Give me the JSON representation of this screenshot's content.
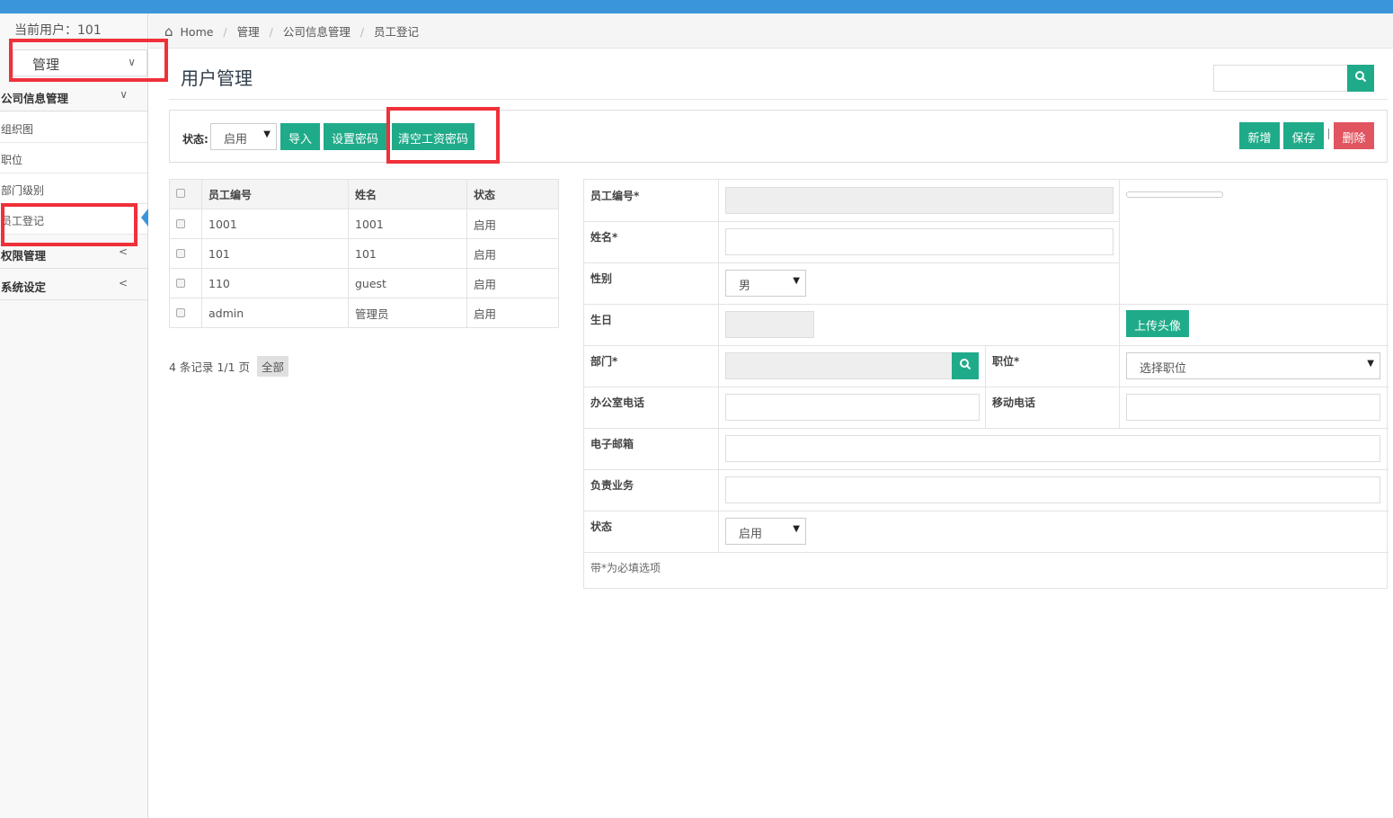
{
  "sidebar": {
    "current_user_label": "当前用户：101",
    "module": "管理",
    "groups": [
      {
        "label": "公司信息管理",
        "items": [
          "组织图",
          "职位",
          "部门级别",
          "员工登记"
        ]
      },
      {
        "label": "权限管理"
      },
      {
        "label": "系统设定"
      }
    ]
  },
  "breadcrumb": [
    "Home",
    "管理",
    "公司信息管理",
    "员工登记"
  ],
  "page_title": "用户管理",
  "toolbar": {
    "status_label": "状态:",
    "status_value": "启用",
    "import": "导入",
    "set_password": "设置密码",
    "clear_salary_password": "清空工资密码",
    "add": "新增",
    "save": "保存",
    "delete": "删除"
  },
  "table": {
    "headers": [
      "员工编号",
      "姓名",
      "状态"
    ],
    "rows": [
      [
        "1001",
        "1001",
        "启用"
      ],
      [
        "101",
        "101",
        "启用"
      ],
      [
        "110",
        "guest",
        "启用"
      ],
      [
        "admin",
        "管理员",
        "启用"
      ]
    ]
  },
  "pager": {
    "summary": "4 条记录 1/1 页",
    "all": "全部"
  },
  "form": {
    "employee_no": "员工编号*",
    "name": "姓名*",
    "gender": "性别",
    "gender_value": "男",
    "birthday": "生日",
    "upload_avatar": "上传头像",
    "department": "部门*",
    "position": "职位*",
    "position_placeholder": "选择职位",
    "office_phone": "办公室电话",
    "mobile_phone": "移动电话",
    "email": "电子邮箱",
    "duties": "负责业务",
    "status": "状态",
    "status_value": "启用",
    "required_note": "带*为必填选项"
  }
}
